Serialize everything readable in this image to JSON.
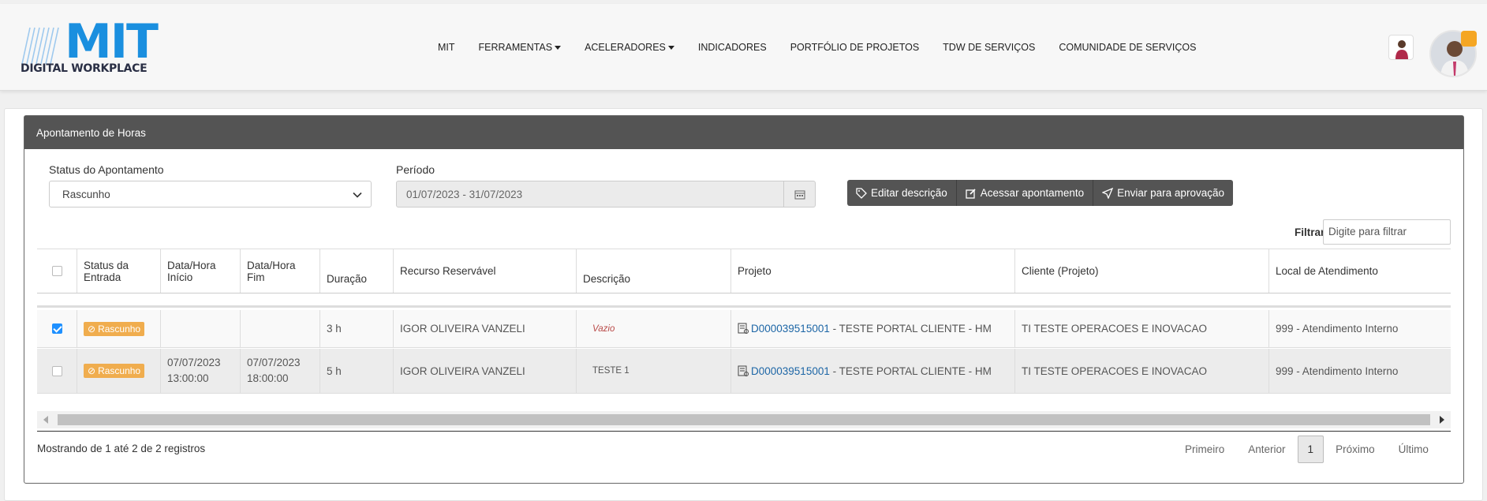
{
  "header": {
    "logo_main": "MIT",
    "logo_sub": "DIGITAL WORKPLACE",
    "nav": [
      {
        "label": "MIT",
        "dropdown": false
      },
      {
        "label": "FERRAMENTAS",
        "dropdown": true
      },
      {
        "label": "ACELERADORES",
        "dropdown": true
      },
      {
        "label": "INDICADORES",
        "dropdown": false
      },
      {
        "label": "PORTFÓLIO DE PROJETOS",
        "dropdown": false
      },
      {
        "label": "TDW DE SERVIÇOS",
        "dropdown": false
      },
      {
        "label": "COMUNIDADE DE SERVIÇOS",
        "dropdown": false
      }
    ],
    "badge_color": "#f5a623"
  },
  "panel": {
    "title": "Apontamento de Horas",
    "status_label": "Status do Apontamento",
    "status_value": "Rascunho",
    "period_label": "Período",
    "period_value": "01/07/2023 - 31/07/2023",
    "buttons": {
      "edit": "Editar descrição",
      "access": "Acessar apontamento",
      "send": "Enviar para aprovação"
    },
    "filter_label": "Filtrar",
    "filter_placeholder": "Digite para filtrar"
  },
  "table": {
    "headers": {
      "status": "Status da Entrada",
      "start": "Data/Hora Início",
      "end": "Data/Hora Fim",
      "duration": "Duração",
      "resource": "Recurso Reservável",
      "description": "Descrição",
      "project": "Projeto",
      "client": "Cliente (Projeto)",
      "location": "Local de Atendimento"
    },
    "rows": [
      {
        "checked": true,
        "status": "Rascunho",
        "start_date": "",
        "start_time": "",
        "end_date": "",
        "end_time": "",
        "duration": "3 h",
        "resource": "IGOR OLIVEIRA VANZELI",
        "description": "Vazio",
        "project_code": "D000039515001",
        "project_name": " - TESTE PORTAL CLIENTE - HM",
        "client": "TI TESTE OPERACOES E INOVACAO",
        "location": "999 - Atendimento Interno"
      },
      {
        "checked": false,
        "status": "Rascunho",
        "start_date": "07/07/2023",
        "start_time": "13:00:00",
        "end_date": "07/07/2023",
        "end_time": "18:00:00",
        "duration": "5 h",
        "resource": "IGOR OLIVEIRA VANZELI",
        "description": "TESTE 1",
        "project_code": "D000039515001",
        "project_name": " - TESTE PORTAL CLIENTE - HM",
        "client": "TI TESTE OPERACOES E INOVACAO",
        "location": "999 - Atendimento Interno"
      }
    ]
  },
  "footer": {
    "info": "Mostrando de 1 até 2 de 2 registros",
    "first": "Primeiro",
    "prev": "Anterior",
    "page": "1",
    "next": "Próximo",
    "last": "Último"
  }
}
